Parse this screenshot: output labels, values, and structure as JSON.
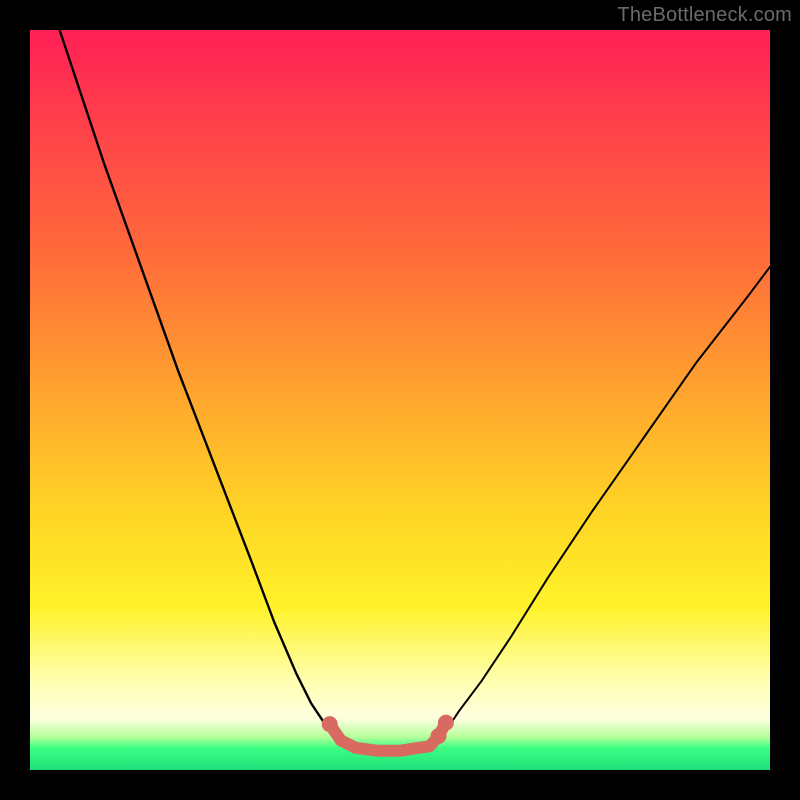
{
  "watermark": "TheBottleneck.com",
  "chart_data": {
    "type": "line",
    "title": "",
    "xlabel": "",
    "ylabel": "",
    "xlim": [
      0,
      100
    ],
    "ylim": [
      0,
      100
    ],
    "background_gradient_stops": [
      {
        "pos": 0,
        "color": "#ff1f56"
      },
      {
        "pos": 10,
        "color": "#ff3a4d"
      },
      {
        "pos": 30,
        "color": "#ff6a3a"
      },
      {
        "pos": 50,
        "color": "#ffa72e"
      },
      {
        "pos": 65,
        "color": "#ffd425"
      },
      {
        "pos": 78,
        "color": "#fff22a"
      },
      {
        "pos": 88,
        "color": "#ffffb0"
      },
      {
        "pos": 93,
        "color": "#ffffe0"
      },
      {
        "pos": 95.5,
        "color": "#b6ff9a"
      },
      {
        "pos": 97,
        "color": "#3dff84"
      },
      {
        "pos": 100,
        "color": "#1de07a"
      }
    ],
    "series": [
      {
        "name": "left-branch",
        "x": [
          4,
          10,
          15,
          20,
          25,
          30,
          33,
          36,
          38,
          40,
          41.5,
          43
        ],
        "y": [
          100,
          82,
          68,
          54,
          41,
          28,
          20,
          13,
          9,
          6,
          4,
          3
        ]
      },
      {
        "name": "right-branch",
        "x": [
          54,
          56,
          58,
          61,
          65,
          70,
          76,
          83,
          90,
          97,
          100
        ],
        "y": [
          3,
          5,
          8,
          12,
          18,
          26,
          35,
          45,
          55,
          64,
          68
        ]
      }
    ],
    "valley_segment": {
      "name": "valley-highlight",
      "color": "#d96a62",
      "points_x": [
        40.5,
        42,
        44,
        47,
        50,
        52.5,
        54,
        55.2,
        56.2
      ],
      "points_y": [
        6.2,
        4.0,
        3.0,
        2.6,
        2.6,
        3.0,
        3.2,
        4.6,
        6.4
      ],
      "bead_indices": [
        0,
        7,
        8
      ]
    }
  }
}
